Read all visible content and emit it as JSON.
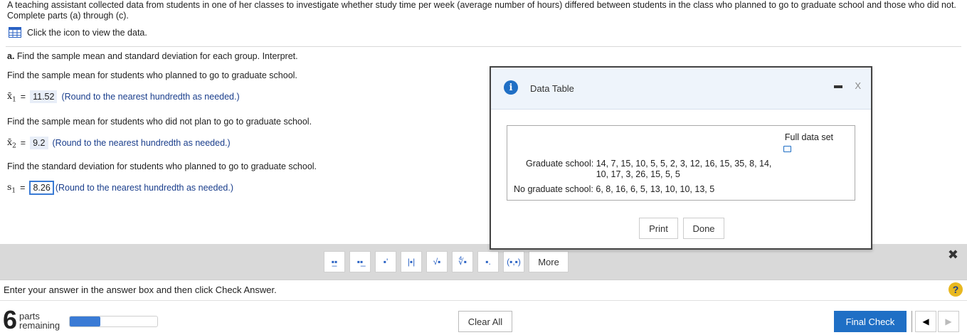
{
  "question": {
    "intro": "A teaching assistant collected data from students in one of her classes to investigate whether study time per week (average number of hours) differed between students in the class who planned to go to graduate school and those who did not. Complete parts (a) through (c).",
    "data_link": "Click the icon to view the data.",
    "part_a_label": "a.",
    "part_a_text": "Find the sample mean and standard deviation for each group. Interpret.",
    "q1": "Find the sample mean for students who planned to go to graduate school.",
    "q1_symbol": "x̄",
    "q1_sub": "1",
    "q1_answer": "11.52",
    "q1_hint": "(Round to the nearest hundredth as needed.)",
    "q2": "Find the sample mean for students who did not plan to go to graduate school.",
    "q2_symbol": "x̄",
    "q2_sub": "2",
    "q2_answer": "9.2",
    "q2_hint": "(Round to the nearest hundredth as needed.)",
    "q3": "Find the standard deviation for students who planned to go to graduate school.",
    "q3_symbol": "s",
    "q3_sub": "1",
    "q3_answer": "8.26",
    "q3_hint": "(Round to the nearest hundredth as needed.)",
    "equals": "="
  },
  "dialog": {
    "title": "Data Table",
    "info_icon": "i",
    "close": "X",
    "full_data_set": "Full data set",
    "grad_label": "Graduate school:",
    "grad_values": "14, 7, 15, 10, 5, 5, 2, 3, 12, 16, 15, 35, 8, 14, 10, 17, 3, 26, 15, 5, 5",
    "nograd_label": "No graduate school:",
    "nograd_values": "6, 8, 16, 6, 5, 13, 10, 10, 13, 5",
    "print_label": "Print",
    "done_label": "Done"
  },
  "toolbar": {
    "tools": [
      "fraction",
      "mixed number",
      "exponent",
      "absolute value",
      "square root",
      "nth root",
      "decimal",
      "ordered pair"
    ],
    "tool_glyphs": [
      "▪̲▪",
      "▪▪̲",
      "▪'",
      "|▪|",
      "√▪",
      "∜▪",
      "▪.",
      "(▪,▪)"
    ],
    "more_label": "More",
    "close_glyph": "✖"
  },
  "footer": {
    "instruction": "Enter your answer in the answer box and then click Check Answer.",
    "help_glyph": "?",
    "parts_count": "6",
    "parts_label_1": "parts",
    "parts_label_2": "remaining",
    "progress_fraction": 0.35,
    "clear_all": "Clear All",
    "final_check": "Final Check",
    "prev_glyph": "◀",
    "next_glyph": "▶"
  }
}
